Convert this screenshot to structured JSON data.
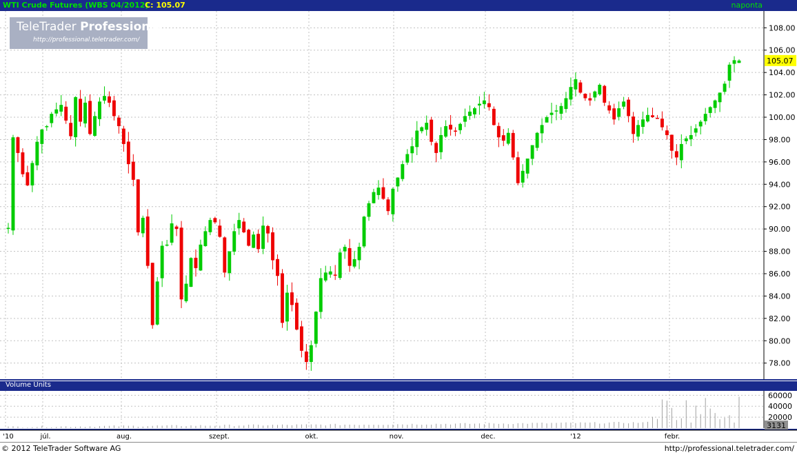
{
  "header": {
    "title": "WTI Crude Futures (WBS 04/2012)",
    "close_label": "C:",
    "close_value": "105.07",
    "interval": "naponta"
  },
  "logo": {
    "brand": "TeleTrader",
    "product": "Professional",
    "url": "http://professional.teletrader.com/"
  },
  "volume_panel": {
    "title": "Volume Units",
    "last_value": "3131"
  },
  "footer": {
    "copyright": "© 2012 TeleTrader Software AG",
    "url": "http://professional.teletrader.com/"
  },
  "colors": {
    "up": "#00cc00",
    "down": "#ee0000",
    "frame": "#1a2a8c",
    "grid": "#c0c0c0",
    "last_price_bg": "#ffff00"
  },
  "chart_data": [
    {
      "type": "candlestick",
      "ylim": [
        76.5,
        109.5
      ],
      "y_ticks": [
        "78.00",
        "80.00",
        "82.00",
        "84.00",
        "86.00",
        "88.00",
        "90.00",
        "92.00",
        "94.00",
        "96.00",
        "98.00",
        "100.00",
        "102.00",
        "104.00",
        "106.00",
        "108.00"
      ],
      "x_labels": [
        "'10",
        "júl.",
        "aug.",
        "szept.",
        "okt.",
        "nov.",
        "dec.",
        "'12",
        "febr."
      ],
      "last_price": "105.07",
      "closes": [
        90.1,
        98.2,
        96.8,
        94.9,
        93.9,
        95.9,
        97.8,
        98.9,
        99.2,
        100.3,
        100.7,
        101.1,
        99.7,
        98.3,
        101.8,
        99.6,
        101.3,
        98.5,
        100.1,
        101.4,
        101.9,
        101.3,
        100.1,
        99.2,
        97.6,
        95.8,
        94.4,
        89.7,
        91.0,
        86.7,
        81.4,
        85.3,
        88.5,
        88.6,
        90.5,
        90.0,
        83.7,
        85.1,
        87.4,
        86.5,
        88.6,
        89.8,
        90.8,
        90.6,
        89.3,
        86.1,
        88.0,
        89.8,
        90.8,
        89.7,
        88.5,
        89.5,
        88.2,
        90.3,
        89.6,
        87.2,
        85.8,
        81.6,
        84.3,
        83.2,
        81.0,
        79.1,
        78.1,
        79.6,
        82.6,
        85.6,
        86.1,
        86.2,
        85.9,
        87.9,
        88.4,
        86.7,
        87.3,
        88.4,
        91.1,
        92.3,
        93.3,
        93.7,
        92.7,
        91.6,
        93.6,
        94.6,
        95.8,
        96.7,
        97.4,
        98.8,
        99.1,
        99.5,
        97.8,
        96.8,
        98.4,
        99.2,
        98.9,
        98.8,
        99.4,
        100.1,
        100.5,
        100.8,
        101.2,
        101.5,
        100.9,
        99.3,
        98.2,
        97.9,
        98.6,
        96.4,
        94.1,
        95.2,
        96.3,
        97.5,
        98.6,
        99.3,
        100.0,
        100.4,
        100.6,
        101.0,
        101.7,
        102.7,
        103.4,
        102.2,
        101.7,
        101.5,
        102.3,
        102.9,
        101.3,
        100.6,
        99.8,
        100.8,
        101.4,
        100.1,
        98.5,
        99.3,
        99.8,
        100.2,
        100.0,
        99.9,
        99.1,
        98.4,
        97.0,
        96.4,
        97.6,
        98.1,
        98.4,
        99.0,
        99.6,
        100.3,
        100.9,
        101.5,
        102.2,
        103.0,
        104.7,
        105.1,
        105.07
      ],
      "volume_ylim": [
        0,
        68000
      ],
      "volume_ticks": [
        "20000",
        "40000",
        "60000"
      ]
    }
  ]
}
